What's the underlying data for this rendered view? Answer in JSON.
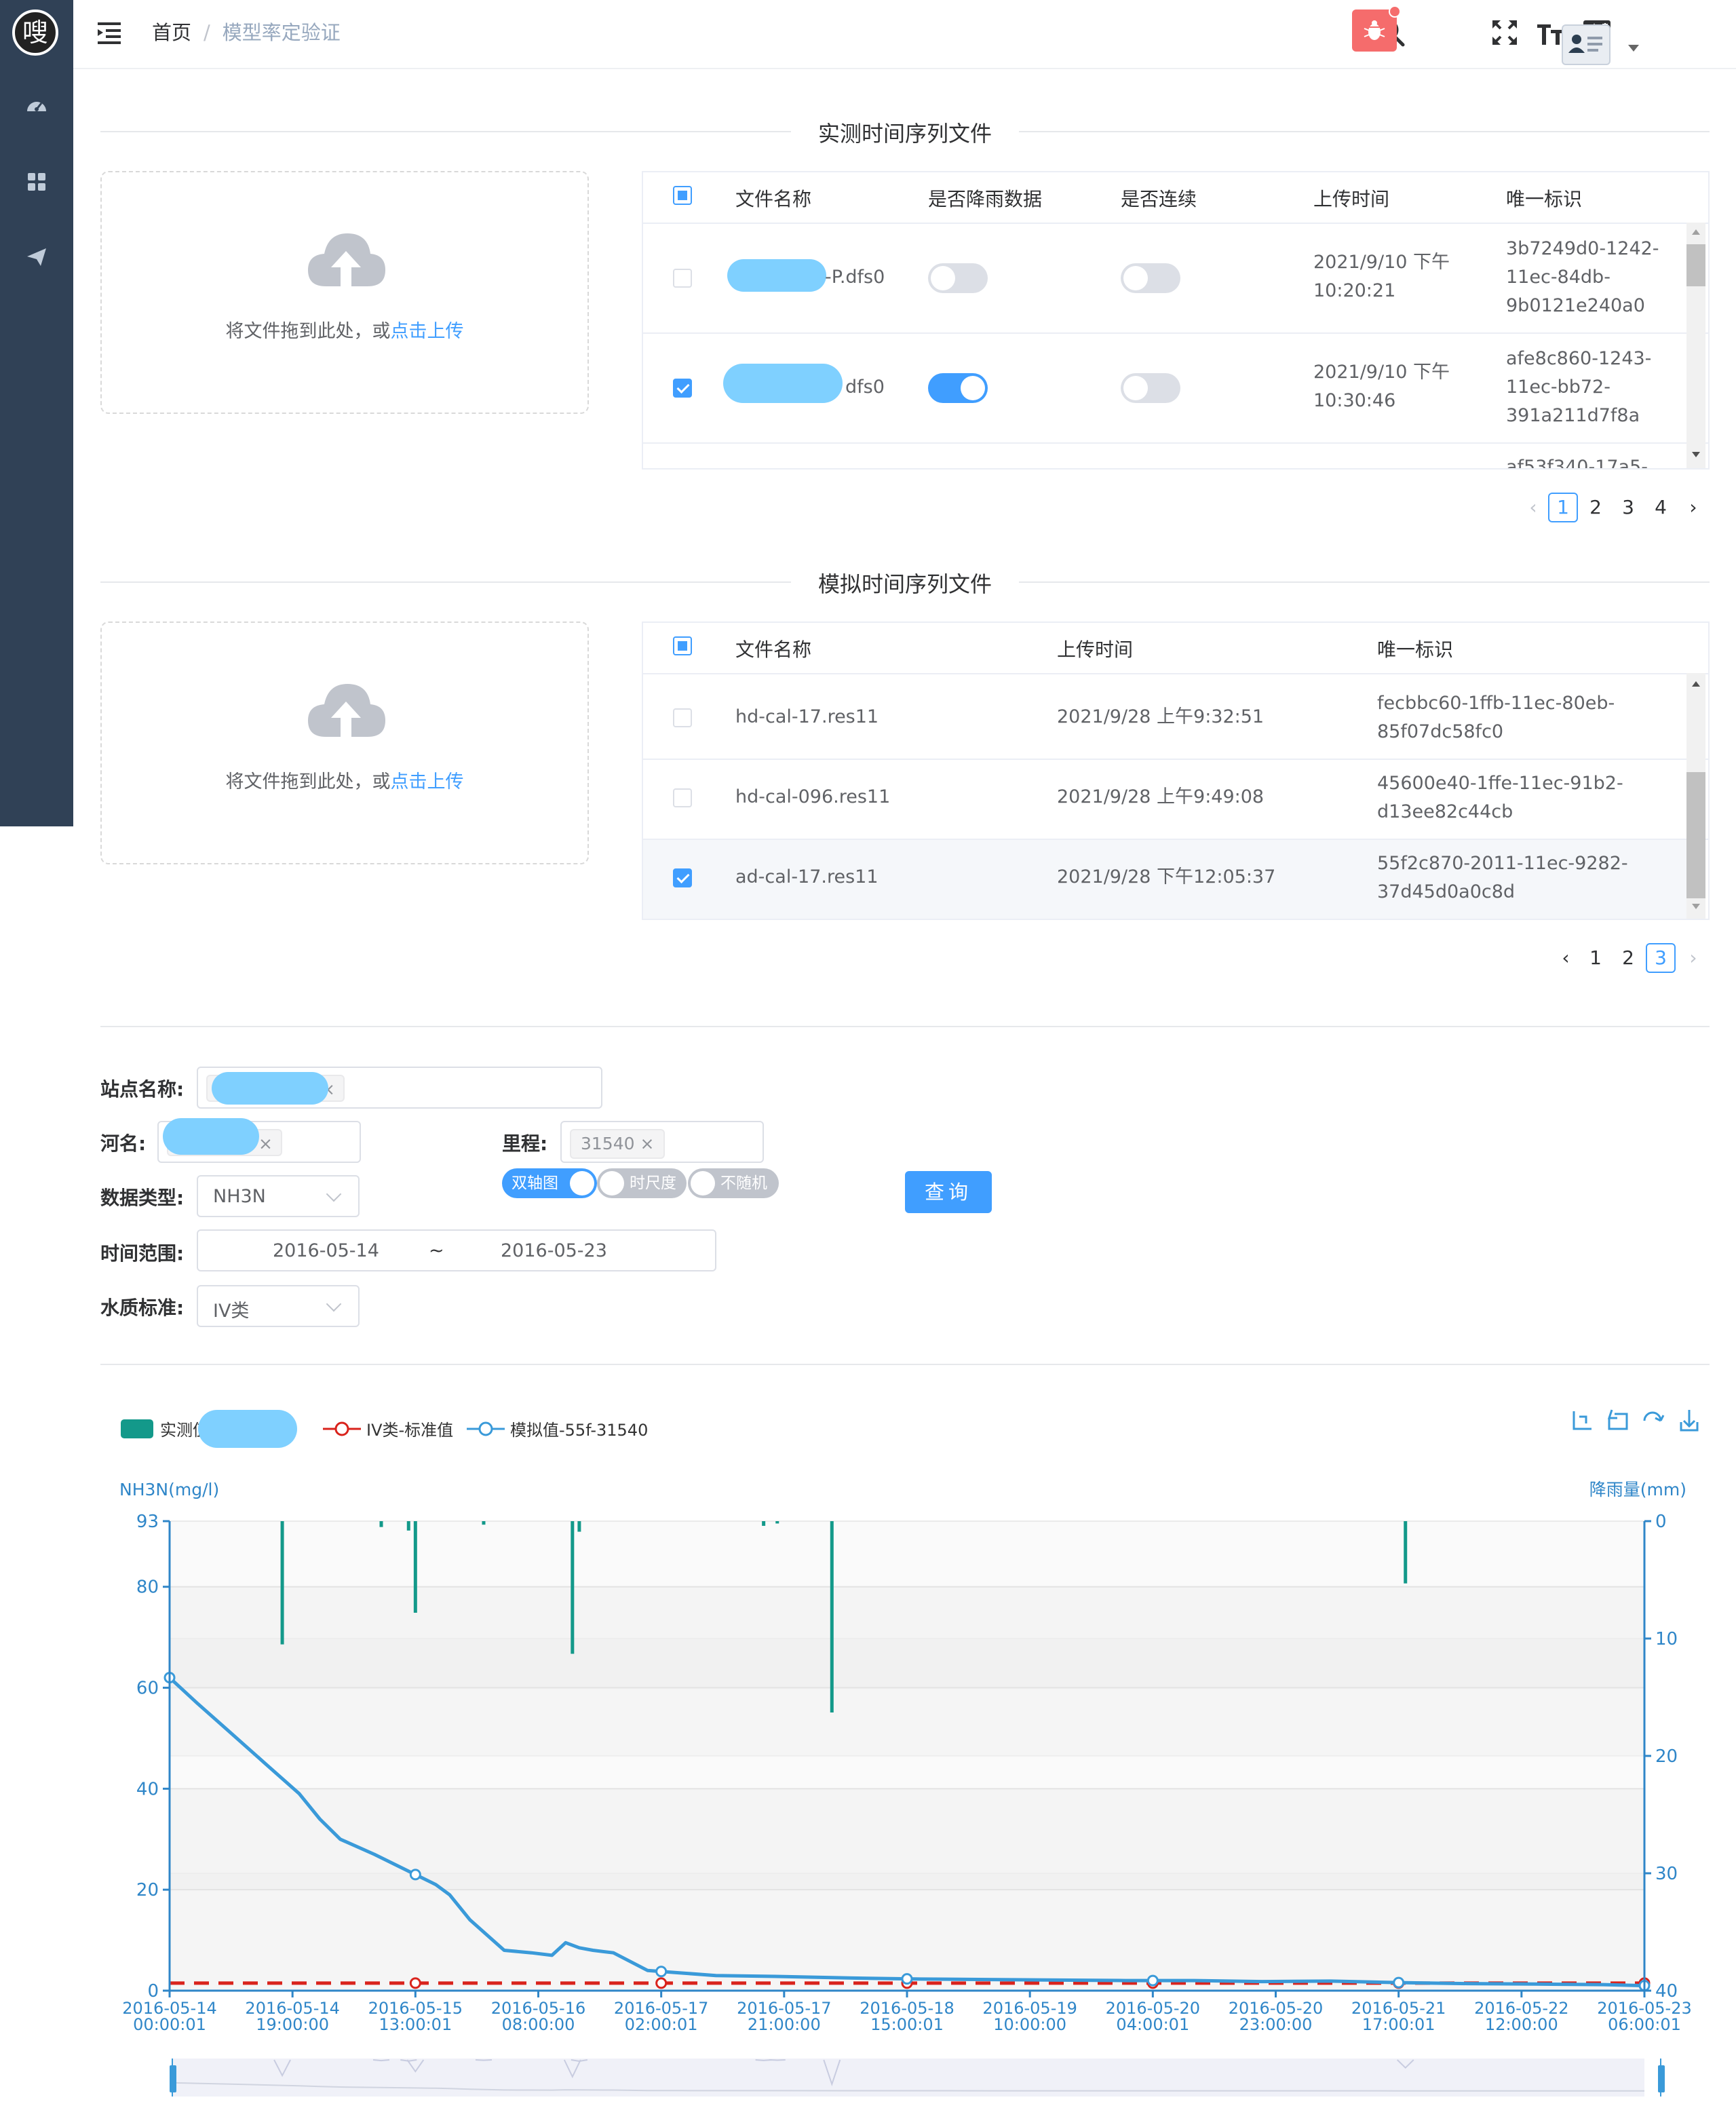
{
  "header": {
    "logo_char": "嗖",
    "breadcrumb_home": "首页",
    "breadcrumb_sep": "/",
    "breadcrumb_current": "模型率定验证"
  },
  "measured": {
    "title": "实测时间序列文件",
    "upload_text": "将文件拖到此处，或",
    "upload_link": "点击上传",
    "columns": [
      "文件名称",
      "是否降雨数据",
      "是否连续",
      "上传时间",
      "唯一标识"
    ],
    "rows": [
      {
        "name": "-P.dfs0",
        "rain": false,
        "continuous": false,
        "time_a": "2021/9/10 下午",
        "time_b": "10:20:21",
        "id_a": "3b7249d0-1242-",
        "id_b": "11ec-84db-",
        "id_c": "9b0121e240a0",
        "checked": false
      },
      {
        "name": "dfs0",
        "rain": true,
        "continuous": false,
        "time_a": "2021/9/10 下午",
        "time_b": "10:30:46",
        "id_a": "afe8c860-1243-",
        "id_b": "11ec-bb72-",
        "id_c": "391a211d7f8a",
        "checked": true
      }
    ],
    "partial_row_id": "af53f340-17a5-",
    "pages": [
      "1",
      "2",
      "3",
      "4"
    ],
    "active_page": "1"
  },
  "simulated": {
    "title": "模拟时间序列文件",
    "upload_text": "将文件拖到此处，或",
    "upload_link": "点击上传",
    "columns": [
      "文件名称",
      "上传时间",
      "唯一标识"
    ],
    "rows": [
      {
        "name": "hd-cal-17.res11",
        "time": "2021/9/28 上午9:32:51",
        "id_a": "fecbbc60-1ffb-11ec-80eb-",
        "id_b": "85f07dc58fc0",
        "checked": false
      },
      {
        "name": "hd-cal-096.res11",
        "time": "2021/9/28 上午9:49:08",
        "id_a": "45600e40-1ffe-11ec-91b2-",
        "id_b": "d13ee82c44cb",
        "checked": false
      },
      {
        "name": "ad-cal-17.res11",
        "time": "2021/9/28 下午12:05:37",
        "id_a": "55f2c870-2011-11ec-9282-",
        "id_b": "37d45d0a0c8d",
        "checked": true
      }
    ],
    "pages": [
      "1",
      "2",
      "3"
    ],
    "active_page": "3"
  },
  "filters": {
    "station_label": "站点名称:",
    "river_label": "河名:",
    "river_tag_tail": "_",
    "mileage_label": "里程:",
    "mileage_tag": "31540",
    "datatype_label": "数据类型:",
    "datatype_value": "NH3N",
    "timerange_label": "时间范围:",
    "date_start": "2016-05-14",
    "date_sep": "~",
    "date_end": "2016-05-23",
    "standard_label": "水质标准:",
    "standard_value": "IV类",
    "switch_dual": "双轴图",
    "switch_timescale": "时尺度",
    "switch_random": "不随机",
    "query_label": "查询"
  },
  "chart_data": {
    "type": "line",
    "legend": [
      {
        "name": "实测值-P",
        "color": "#13998a"
      },
      {
        "name": "IV类-标准值",
        "color": "#d9231c"
      },
      {
        "name": "模拟值-55f-31540",
        "color": "#3a9ad9"
      }
    ],
    "ylabel": "NH3N(mg/l)",
    "ylabel_right": "降雨量(mm)",
    "ylim": [
      0,
      93
    ],
    "yticks": [
      0,
      20,
      40,
      60,
      80,
      93
    ],
    "ylim_right": [
      0,
      40
    ],
    "yticks_right": [
      0,
      10,
      20,
      30,
      40
    ],
    "x_labels": [
      [
        "2016-05-14",
        "00:00:01"
      ],
      [
        "2016-05-14",
        "19:00:00"
      ],
      [
        "2016-05-15",
        "13:00:01"
      ],
      [
        "2016-05-16",
        "08:00:00"
      ],
      [
        "2016-05-17",
        "02:00:01"
      ],
      [
        "2016-05-17",
        "21:00:00"
      ],
      [
        "2016-05-18",
        "15:00:01"
      ],
      [
        "2016-05-19",
        "10:00:00"
      ],
      [
        "2016-05-20",
        "04:00:01"
      ],
      [
        "2016-05-20",
        "23:00:00"
      ],
      [
        "2016-05-21",
        "17:00:01"
      ],
      [
        "2016-05-22",
        "12:00:00"
      ],
      [
        "2016-05-23",
        "06:00:01"
      ]
    ],
    "simulated_series": {
      "name": "模拟值-55f-31540",
      "x_hours": [
        0,
        4,
        9,
        14,
        19,
        22,
        25,
        30,
        36,
        39,
        41,
        44,
        49,
        53,
        56,
        58,
        60,
        62,
        65,
        70,
        75,
        80,
        90,
        100,
        110,
        120,
        130,
        140,
        150,
        160,
        170,
        180,
        190,
        200,
        210,
        216
      ],
      "values": [
        62,
        57,
        51,
        45,
        39,
        34,
        30,
        27,
        23,
        21,
        19,
        14,
        8,
        7.5,
        7,
        9.5,
        8.5,
        8,
        7.5,
        4,
        3.5,
        3,
        2.8,
        2.5,
        2.3,
        2.2,
        2.1,
        2,
        2,
        1.8,
        1.9,
        1.6,
        1.4,
        1.3,
        1.2,
        1
      ]
    },
    "standard_series": {
      "name": "IV类-标准值",
      "value": 1.5
    },
    "rain_series": {
      "name": "实测值-P",
      "x_hours": [
        16.5,
        31,
        35,
        36,
        46,
        59,
        60,
        87,
        89,
        97,
        181
      ],
      "values": [
        10.5,
        0.5,
        0.8,
        7.8,
        0.3,
        11.3,
        0.9,
        0.4,
        0.2,
        16.3,
        5.3
      ]
    }
  },
  "colors": {
    "sidebar": "#304156",
    "primary": "#409eff",
    "danger": "#f56c6c"
  }
}
